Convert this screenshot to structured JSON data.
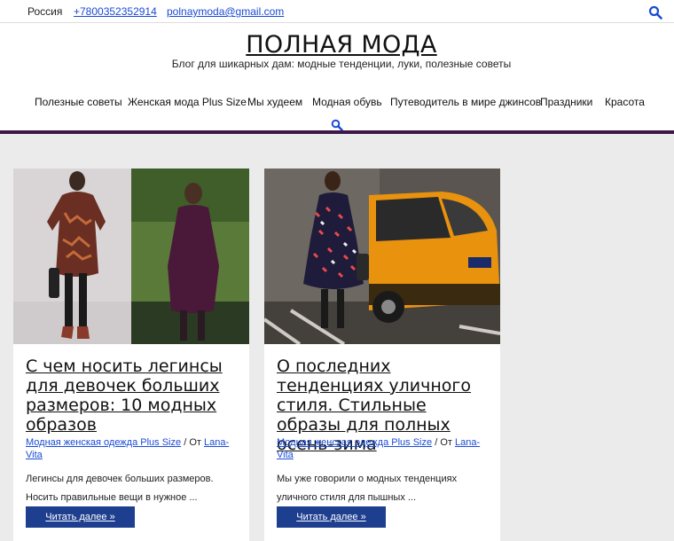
{
  "topbar": {
    "country": "Россия",
    "phone": "+7800352352914",
    "email": "polnaymoda@gmail.com",
    "search_icon": "search-icon"
  },
  "header": {
    "site_title": "ПОЛНАЯ МОДА",
    "tagline": "Блог для шикарных дам: модные тенденции, луки, полезные советы"
  },
  "nav": {
    "items": [
      {
        "label": "Полезные советы"
      },
      {
        "label": "Женская мода Plus Size"
      },
      {
        "label": "Мы худеем"
      },
      {
        "label": "Модная обувь"
      },
      {
        "label": "Путеводитель в мире джинсов"
      },
      {
        "label": "Праздники"
      },
      {
        "label": "Красота"
      }
    ],
    "search_icon": "search-icon"
  },
  "colors": {
    "accent_bar": "#3d1747",
    "link": "#1a4bd6",
    "button": "#1e3f8f"
  },
  "posts": [
    {
      "title": "С чем носить легинсы для девочек больших размеров: 10 модных образов",
      "category": "Модная женская одежда Plus Size",
      "by": "От",
      "author": "Lana-Vita",
      "excerpt_line1": "Легинсы для девочек больших размеров.",
      "excerpt_line2": "Носить правильные вещи в нужное ...",
      "button": "Читать далее »"
    },
    {
      "title": "О последних тенденциях уличного стиля. Стильные образы для полных осень-зима",
      "category": "Модная женская одежда Plus Size",
      "by": "От",
      "author": "Lana-Vita",
      "excerpt_line1": "Мы уже говорили о модных тенденциях",
      "excerpt_line2": "уличного стиля для пышных ...",
      "button": "Читать далее »"
    }
  ]
}
